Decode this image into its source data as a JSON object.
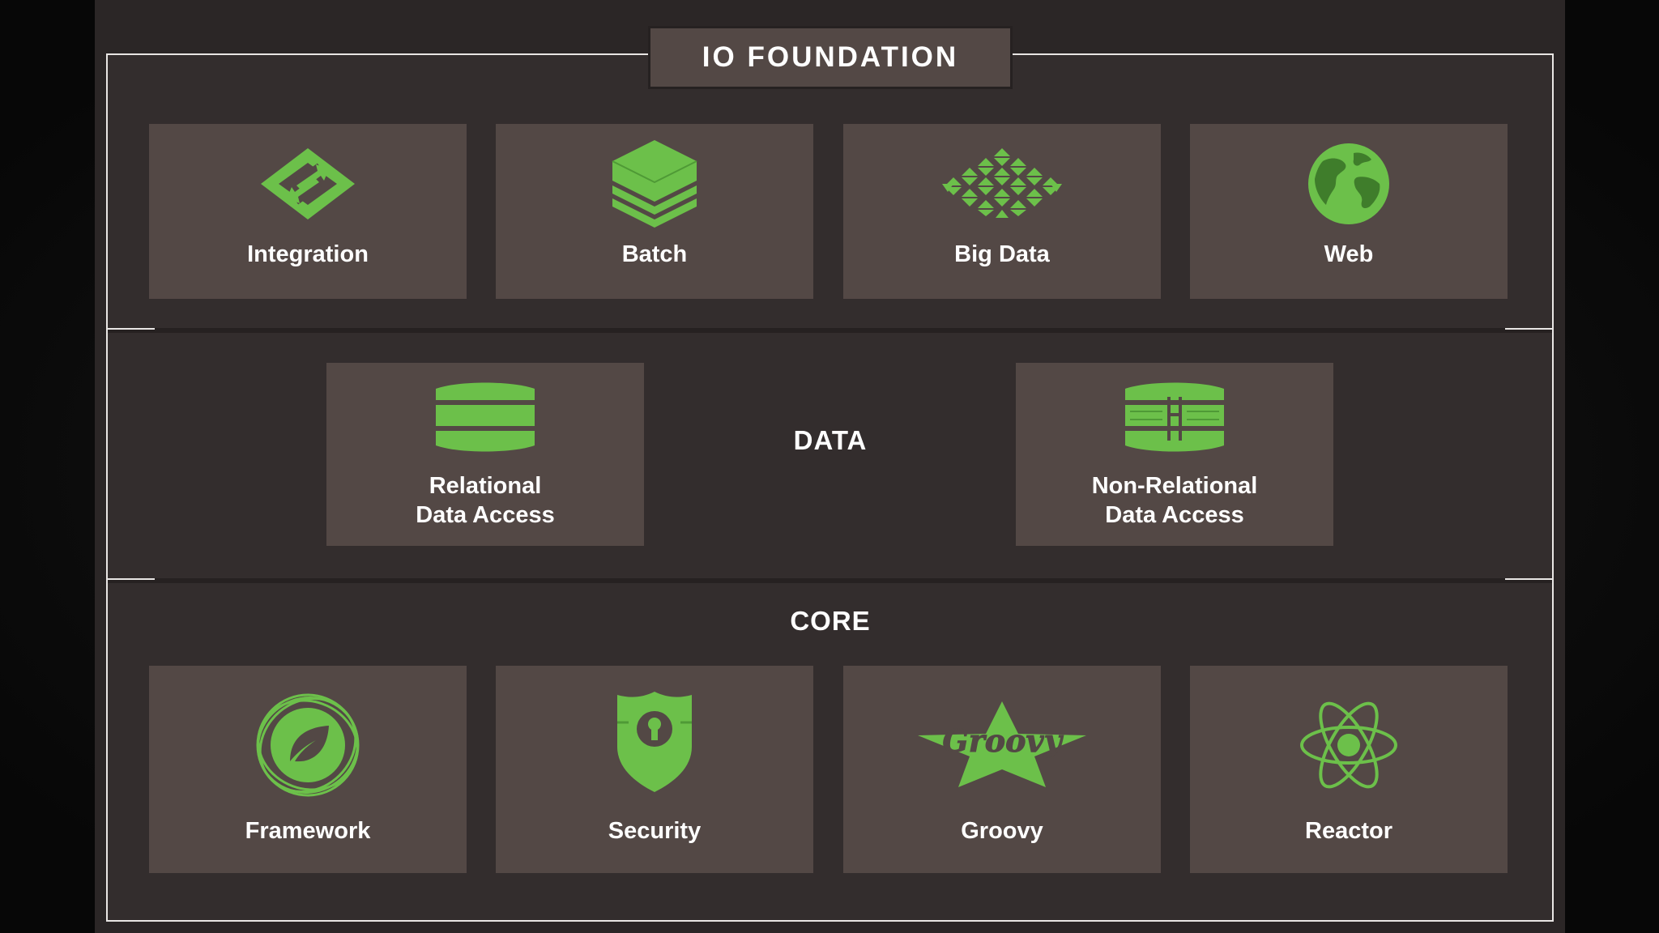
{
  "diagram": {
    "header": "IO FOUNDATION",
    "io_tiles": [
      {
        "label": "Integration",
        "icon": "integration-icon"
      },
      {
        "label": "Batch",
        "icon": "batch-layers-icon"
      },
      {
        "label": "Big Data",
        "icon": "big-data-grid-icon"
      },
      {
        "label": "Web",
        "icon": "globe-icon"
      }
    ],
    "data_section": {
      "label": "DATA",
      "tiles": [
        {
          "line1": "Relational",
          "line2": "Data Access",
          "icon": "relational-database-icon"
        },
        {
          "line1": "Non-Relational",
          "line2": "Data Access",
          "icon": "non-relational-database-icon"
        }
      ]
    },
    "core_section": {
      "label": "CORE",
      "tiles": [
        {
          "label": "Framework",
          "icon": "spring-leaf-icon"
        },
        {
          "label": "Security",
          "icon": "shield-keyhole-icon"
        },
        {
          "label": "Groovy",
          "icon": "groovy-star-icon",
          "logo_text": "Groovy"
        },
        {
          "label": "Reactor",
          "icon": "atom-icon"
        }
      ]
    },
    "colors": {
      "accent_green": "#6cc04a",
      "tile": "#534845",
      "background": "#332d2d",
      "frame": "#e9e6e4"
    }
  }
}
